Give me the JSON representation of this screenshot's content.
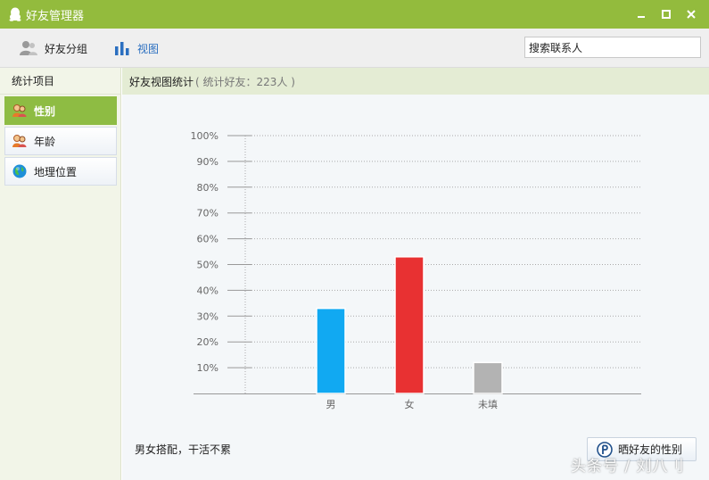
{
  "window": {
    "title": "好友管理器",
    "accent_color": "#93bb3d",
    "buttons": [
      "minimize",
      "maximize",
      "close"
    ]
  },
  "toolbar": {
    "groups_label": "好友分组",
    "view_label": "视图",
    "search": {
      "value": "搜索联系人",
      "placeholder": "搜索联系人"
    }
  },
  "sidebar": {
    "header": "统计项目",
    "items": [
      {
        "label": "性别",
        "icon": "people-icon",
        "active": true
      },
      {
        "label": "年龄",
        "icon": "people-icon",
        "active": false
      },
      {
        "label": "地理位置",
        "icon": "globe-icon",
        "active": false
      }
    ]
  },
  "main": {
    "header_title": "好友视图统计",
    "header_sub": "( 统计好友：223人 )",
    "footer_text": "男女搭配，干活不累",
    "share_label": "晒好友的性别"
  },
  "watermark": "头条号 / 刘八刂",
  "chart_data": {
    "type": "bar",
    "categories": [
      "男",
      "女",
      "未填"
    ],
    "values": [
      33,
      53,
      12
    ],
    "colors": [
      "#11a9f2",
      "#e83132",
      "#b3b3b3"
    ],
    "yticks": [
      "10%",
      "20%",
      "30%",
      "40%",
      "50%",
      "60%",
      "70%",
      "80%",
      "90%",
      "100%"
    ],
    "ylim": [
      0,
      100
    ],
    "grid": true,
    "legend": "none",
    "title": "",
    "xlabel": "",
    "ylabel": ""
  }
}
